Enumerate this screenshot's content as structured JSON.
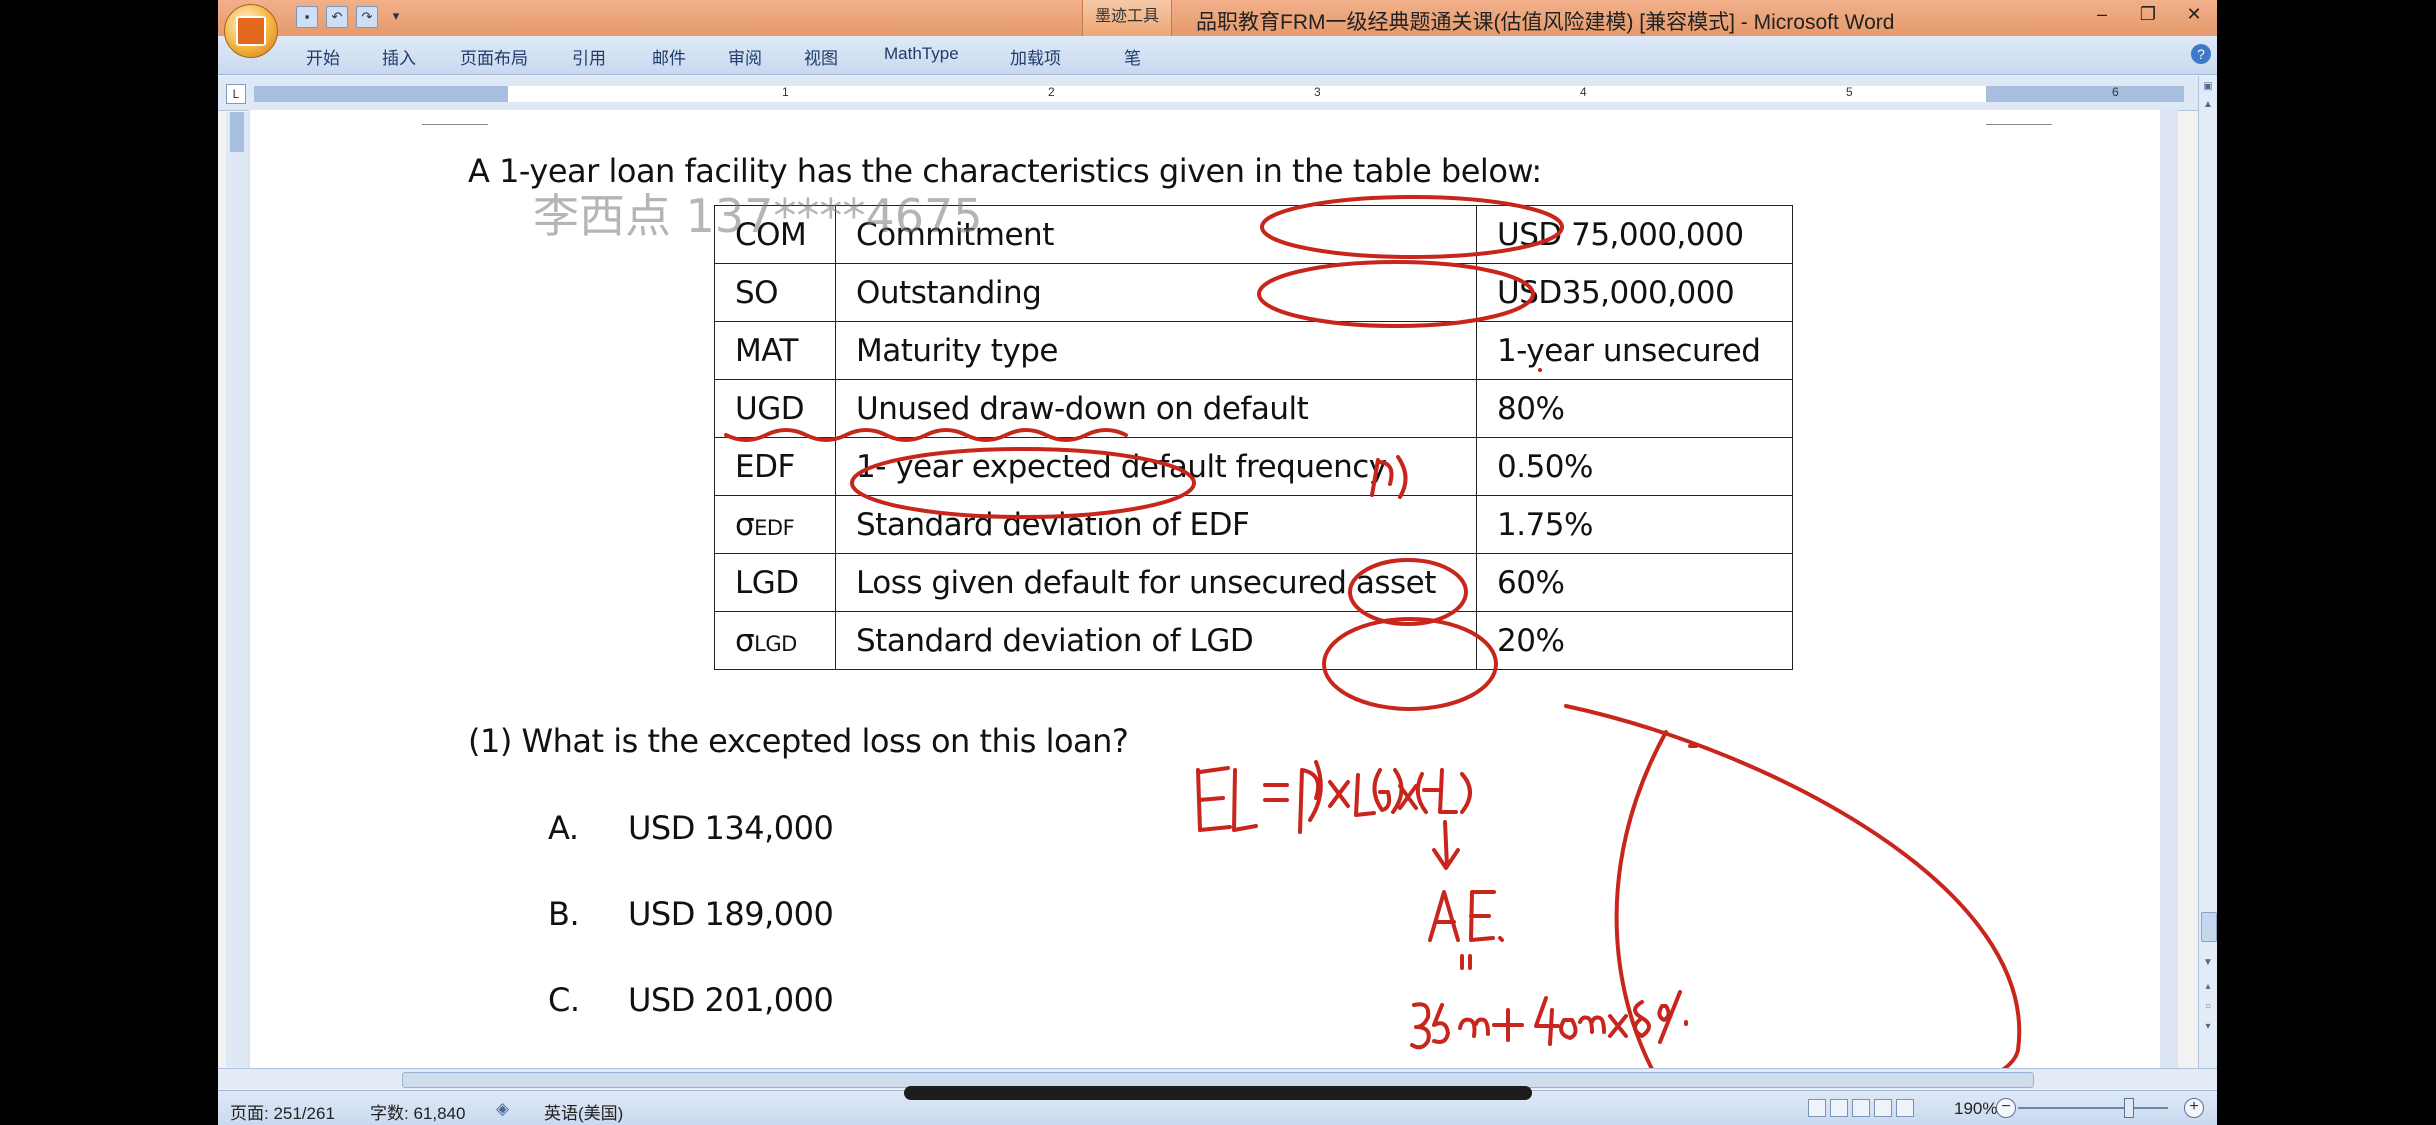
{
  "window": {
    "title": "品职教育FRM一级经典题通关课(估值风险建模) [兼容模式] - Microsoft Word",
    "context_tab": "墨迹工具",
    "controls": [
      "–",
      "❐",
      "✕"
    ]
  },
  "ribbon": {
    "tabs": [
      "开始",
      "插入",
      "页面布局",
      "引用",
      "邮件",
      "审阅",
      "视图",
      "MathType",
      "加载项",
      "笔"
    ]
  },
  "ruler": {
    "numbers": [
      "1",
      "2",
      "3",
      "4",
      "5",
      "6"
    ]
  },
  "document": {
    "intro": "A 1-year loan facility has the characteristics given in the table below:",
    "watermark": "李西点 137****4675",
    "table": [
      {
        "abbr": "COM",
        "desc": "Commitment",
        "value": "USD 75,000,000"
      },
      {
        "abbr": "SO",
        "desc": "Outstanding",
        "value": "USD35,000,000"
      },
      {
        "abbr": "MAT",
        "desc": "Maturity type",
        "value": "1-year unsecured"
      },
      {
        "abbr": "UGD",
        "desc": "Unused draw-down on default",
        "value": "80%"
      },
      {
        "abbr": "EDF",
        "desc": "1- year expected default frequency",
        "value": "0.50%"
      },
      {
        "abbr": "σ",
        "abbr_sub": "EDF",
        "desc": "Standard deviation of EDF",
        "value": "1.75%"
      },
      {
        "abbr": "LGD",
        "desc": "Loss given default for unsecured asset",
        "value": "60%"
      },
      {
        "abbr": "σ",
        "abbr_sub": "LGD",
        "desc": "Standard deviation of LGD",
        "value": "20%"
      }
    ],
    "question": "(1) What is the excepted loss on this loan?",
    "options": [
      {
        "letter": "A.",
        "text": "USD 134,000"
      },
      {
        "letter": "B.",
        "text": "USD 189,000"
      },
      {
        "letter": "C.",
        "text": "USD 201,000"
      }
    ],
    "ink_color": "#c8251c"
  },
  "statusbar": {
    "page": "页面: 251/261",
    "words": "字数: 61,840",
    "language": "英语(美国)",
    "zoom": "190%"
  }
}
